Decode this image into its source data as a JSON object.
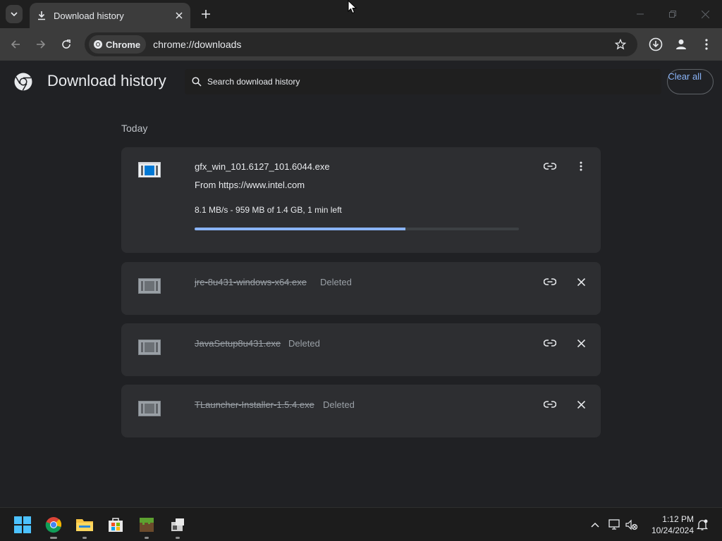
{
  "tab": {
    "title": "Download history"
  },
  "toolbar": {
    "chip_label": "Chrome",
    "url": "chrome://downloads"
  },
  "page": {
    "title": "Download history",
    "search_placeholder": "Search download history",
    "clear_all": "Clear all",
    "section": "Today"
  },
  "downloads": [
    {
      "name": "gfx_win_101.6127_101.6044.exe",
      "from": "From https://www.intel.com",
      "progress_text": "8.1 MB/s - 959 MB of 1.4 GB, 1 min left",
      "progress_fraction": 0.65
    },
    {
      "name": "jre-8u431-windows-x64.exe",
      "status": "Deleted"
    },
    {
      "name": "JavaSetup8u431.exe",
      "status": "Deleted"
    },
    {
      "name": "TLauncher-Installer-1.5.4.exe",
      "status": "Deleted"
    }
  ],
  "taskbar": {
    "time": "1:12 PM",
    "date": "10/24/2024"
  },
  "colors": {
    "accent": "#8ab4f8",
    "background": "#202124",
    "card": "#2d2e31"
  }
}
